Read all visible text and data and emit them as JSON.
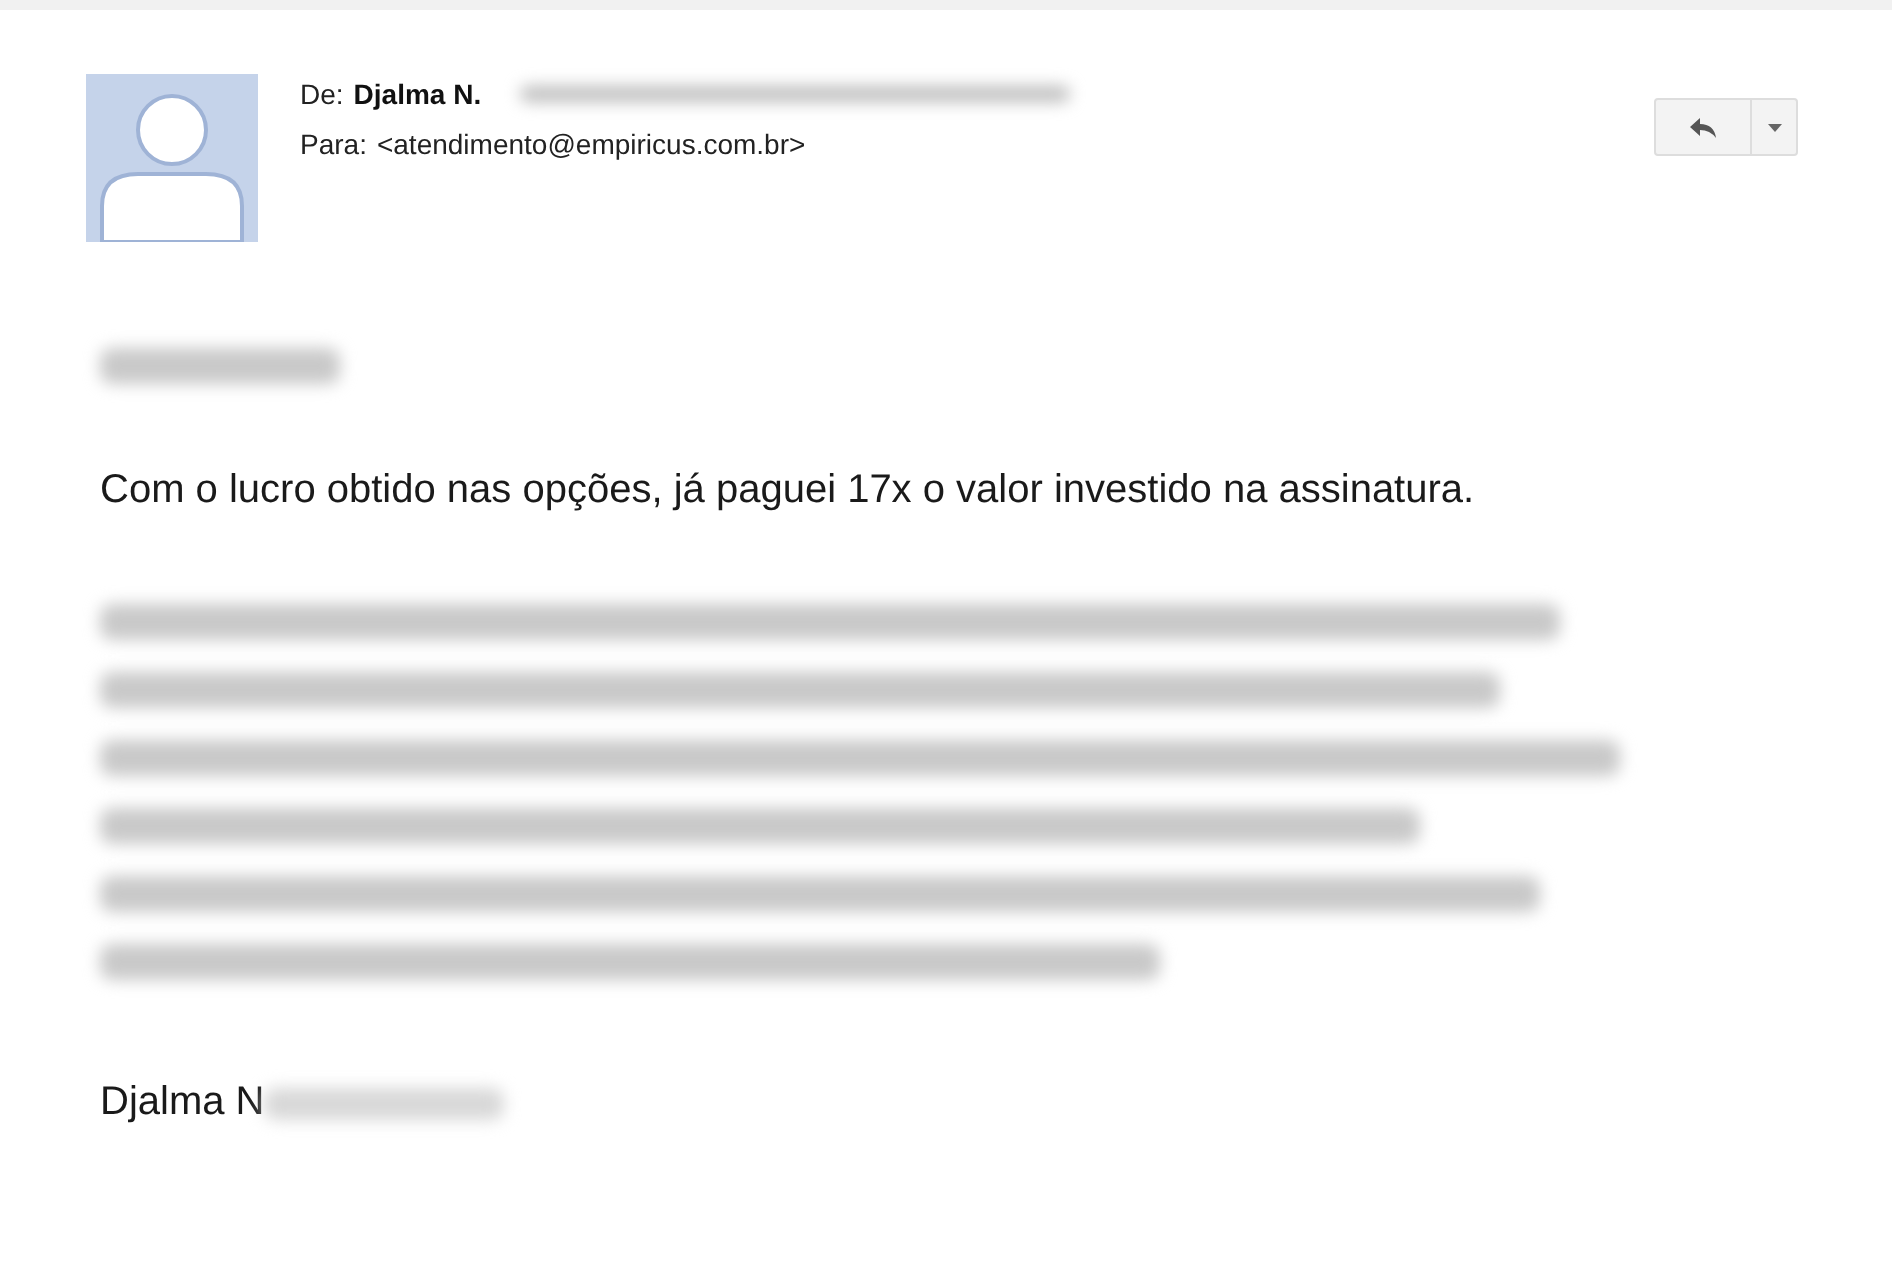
{
  "header": {
    "from_label": "De:",
    "from_name": "Djalma N.",
    "from_email_redacted": true,
    "to_label": "Para:",
    "to_address": "<atendimento@empiricus.com.br>"
  },
  "actions": [
    {
      "kind": "reply"
    },
    {
      "kind": "more"
    }
  ],
  "body": [
    {
      "kind": "redacted-short"
    },
    {
      "kind": "text",
      "text": "Com o lucro obtido nas opções, já paguei 17x o valor investido na assinatura."
    },
    {
      "kind": "redacted-paragraph"
    },
    {
      "kind": "signature",
      "text": "Djalma N",
      "redacted_tail": true
    }
  ]
}
